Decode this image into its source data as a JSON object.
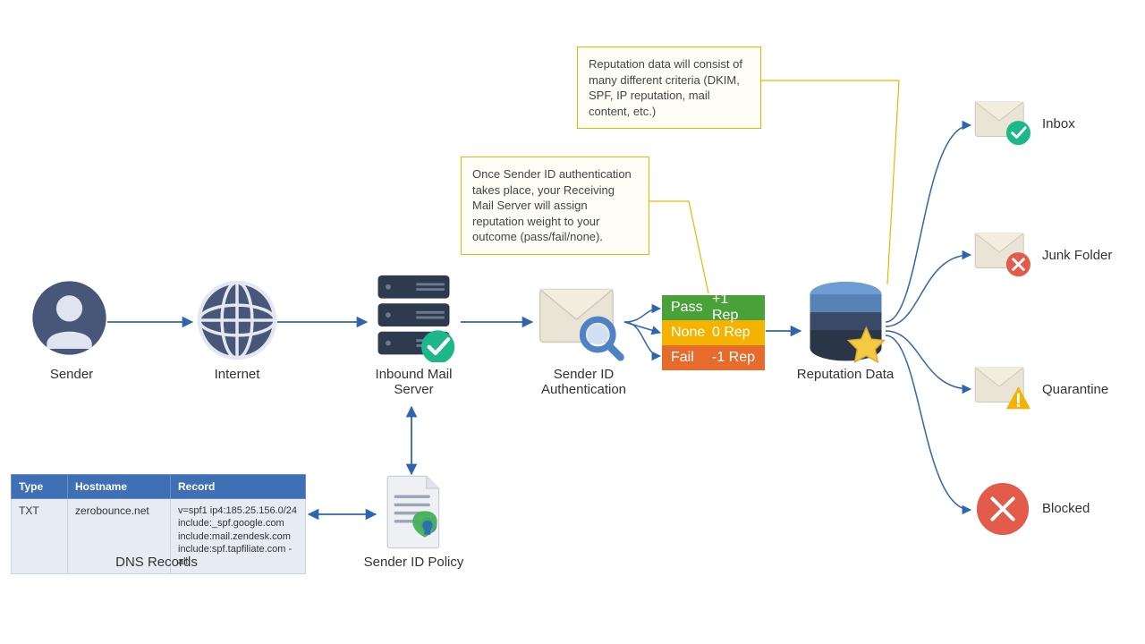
{
  "nodes": {
    "sender": "Sender",
    "internet": "Internet",
    "inbound": "Inbound Mail Server",
    "senderid": "Sender ID Authentication",
    "repdata": "Reputation Data",
    "senderpolicy": "Sender ID Policy",
    "dnsrecords": "DNS Records"
  },
  "callouts": {
    "top": "Reputation data will consist of many different criteria (DKIM, SPF, IP reputation, mail content, etc.)",
    "mid": "Once Sender ID authentication takes place, your Receiving Mail Server will assign reputation weight to your outcome (pass/fail/none)."
  },
  "rep": {
    "pass_k": "Pass",
    "pass_v": "+1 Rep",
    "none_k": "None",
    "none_v": "0 Rep",
    "fail_k": "Fail",
    "fail_v": "-1 Rep"
  },
  "outcomes": {
    "inbox": "Inbox",
    "junk": "Junk Folder",
    "quarantine": "Quarantine",
    "blocked": "Blocked"
  },
  "dns": {
    "headers": {
      "type": "Type",
      "hostname": "Hostname",
      "record": "Record"
    },
    "row": {
      "type": "TXT",
      "hostname": "zerobounce.net",
      "record": "v=spf1 ip4:185.25.156.0/24 include:_spf.google.com include:mail.zendesk.com include:spf.tapfiliate.com   -all"
    }
  }
}
